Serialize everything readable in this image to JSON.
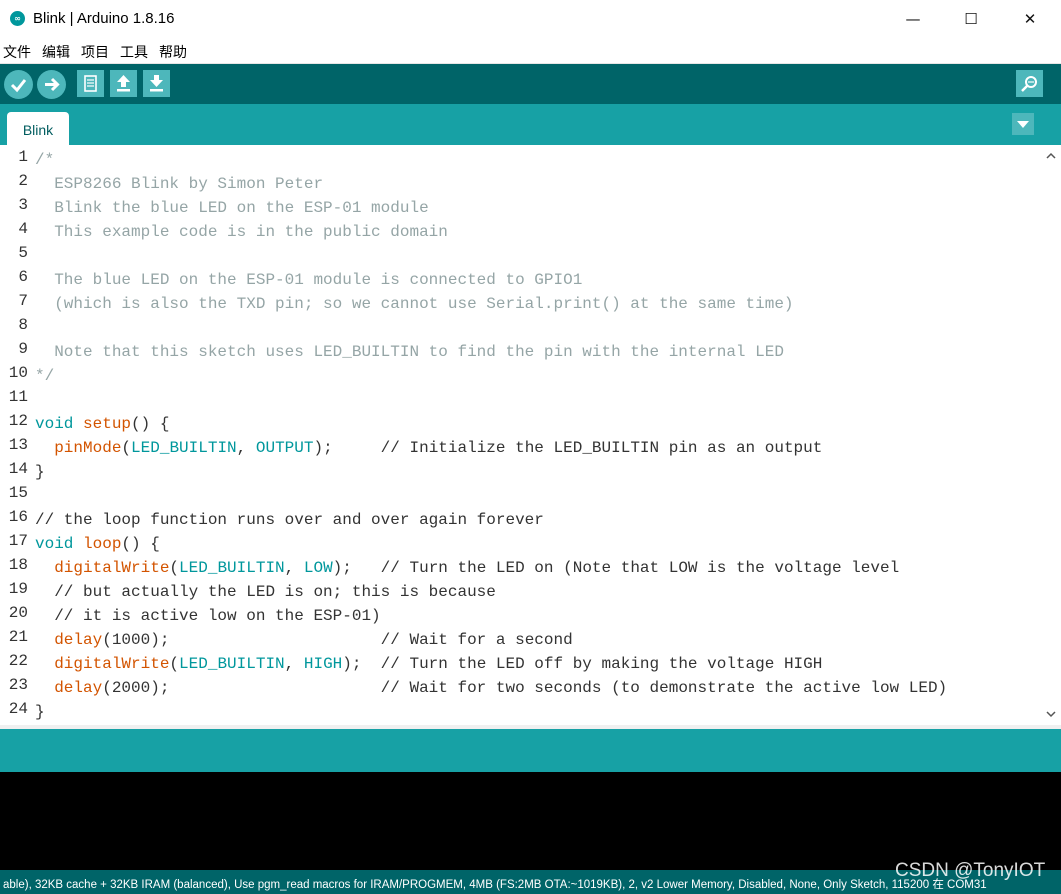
{
  "window": {
    "title": "Blink | Arduino 1.8.16",
    "app_icon": "arduino-logo-icon",
    "app_icon_glyph": "∞",
    "controls": {
      "minimize": "—",
      "maximize": "☐",
      "close": "✕"
    }
  },
  "menu": [
    "文件",
    "编辑",
    "项目",
    "工具",
    "帮助"
  ],
  "toolbar": {
    "buttons": [
      "verify-icon",
      "upload-icon",
      "new-icon",
      "open-icon",
      "save-icon"
    ],
    "serial_monitor": "serial-monitor-icon"
  },
  "tabs": [
    {
      "label": "Blink"
    }
  ],
  "editor": {
    "line_numbers": [
      "1",
      "2",
      "3",
      "4",
      "5",
      "6",
      "7",
      "8",
      "9",
      "10",
      "11",
      "12",
      "13",
      "14",
      "15",
      "16",
      "17",
      "18",
      "19",
      "20",
      "21",
      "22",
      "23",
      "24"
    ],
    "lines": [
      [
        {
          "t": "/*",
          "c": "cm"
        }
      ],
      [
        {
          "t": "  ESP8266 Blink by Simon Peter",
          "c": "cm"
        }
      ],
      [
        {
          "t": "  Blink the blue LED on the ESP-01 module",
          "c": "cm"
        }
      ],
      [
        {
          "t": "  This example code is in the public domain",
          "c": "cm"
        }
      ],
      [],
      [
        {
          "t": "  The blue LED on the ESP-01 module is connected to GPIO1",
          "c": "cm"
        }
      ],
      [
        {
          "t": "  (which is also the TXD pin; so we cannot use Serial.print() at the same time)",
          "c": "cm"
        }
      ],
      [],
      [
        {
          "t": "  Note that this sketch uses LED_BUILTIN to find the pin with the internal LED",
          "c": "cm"
        }
      ],
      [
        {
          "t": "*/",
          "c": "cm"
        }
      ],
      [],
      [
        {
          "t": "void",
          "c": "kw"
        },
        {
          "t": " "
        },
        {
          "t": "setup",
          "c": "fn"
        },
        {
          "t": "() {"
        }
      ],
      [
        {
          "t": "  "
        },
        {
          "t": "pinMode",
          "c": "fn"
        },
        {
          "t": "("
        },
        {
          "t": "LED_BUILTIN",
          "c": "ct"
        },
        {
          "t": ", "
        },
        {
          "t": "OUTPUT",
          "c": "ct"
        },
        {
          "t": ");     // Initialize the LED_BUILTIN pin as an output"
        }
      ],
      [
        {
          "t": "}"
        }
      ],
      [],
      [
        {
          "t": "// the loop function runs over and over again forever"
        }
      ],
      [
        {
          "t": "void",
          "c": "kw"
        },
        {
          "t": " "
        },
        {
          "t": "loop",
          "c": "fn"
        },
        {
          "t": "() {"
        }
      ],
      [
        {
          "t": "  "
        },
        {
          "t": "digitalWrite",
          "c": "fn"
        },
        {
          "t": "("
        },
        {
          "t": "LED_BUILTIN",
          "c": "ct"
        },
        {
          "t": ", "
        },
        {
          "t": "LOW",
          "c": "ct"
        },
        {
          "t": ");   // Turn the LED on (Note that LOW is the voltage level"
        }
      ],
      [
        {
          "t": "  // but actually the LED is on; this is because"
        }
      ],
      [
        {
          "t": "  // it is active low on the ESP-01)"
        }
      ],
      [
        {
          "t": "  "
        },
        {
          "t": "delay",
          "c": "fn"
        },
        {
          "t": "(1000);                      // Wait for a second"
        }
      ],
      [
        {
          "t": "  "
        },
        {
          "t": "digitalWrite",
          "c": "fn"
        },
        {
          "t": "("
        },
        {
          "t": "LED_BUILTIN",
          "c": "ct"
        },
        {
          "t": ", "
        },
        {
          "t": "HIGH",
          "c": "ct"
        },
        {
          "t": ");  // Turn the LED off by making the voltage HIGH"
        }
      ],
      [
        {
          "t": "  "
        },
        {
          "t": "delay",
          "c": "fn"
        },
        {
          "t": "(2000);                      // Wait for two seconds (to demonstrate the active low LED)"
        }
      ],
      [
        {
          "t": "}"
        }
      ]
    ]
  },
  "bottom_bar": {
    "text": "able), 32KB cache + 32KB IRAM (balanced), Use pgm_read macros for IRAM/PROGMEM, 4MB (FS:2MB OTA:~1019KB), 2, v2 Lower Memory, Disabled, None, Only Sketch, 115200 在 COM31"
  },
  "watermark": "CSDN @TonyIOT",
  "colors": {
    "toolbar": "#006468",
    "tabs_bar": "#17a1a5",
    "button": "#4db7bb",
    "comment": "#95a5a6",
    "keyword": "#00979c",
    "function": "#d35400"
  }
}
